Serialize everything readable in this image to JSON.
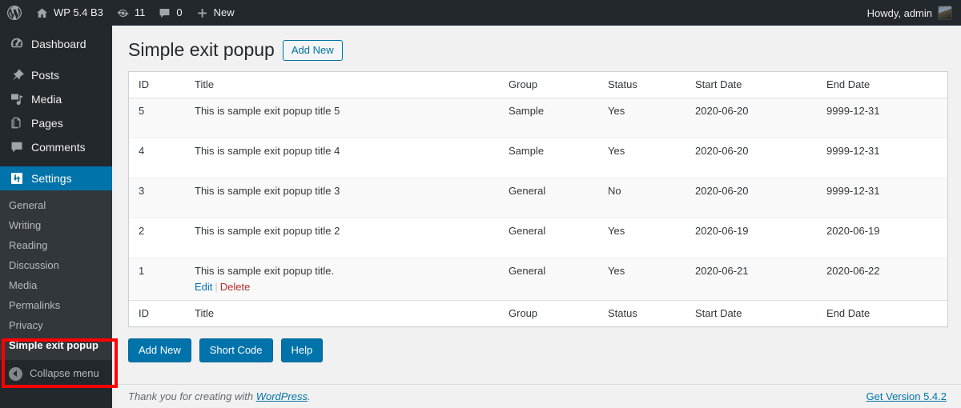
{
  "adminbar": {
    "logo_icon": "wordpress-logo-icon",
    "site": {
      "icon": "home-icon",
      "label": "WP 5.4 B3"
    },
    "updates": {
      "icon": "updates-icon",
      "count": "11"
    },
    "comments": {
      "icon": "comment-bubble-icon",
      "count": "0"
    },
    "new": {
      "icon": "plus-icon",
      "label": "New"
    },
    "account": {
      "greeting": "Howdy, admin",
      "avatar_icon": "user-avatar-icon"
    }
  },
  "sidebar": {
    "top_items": [
      {
        "label": "Dashboard",
        "icon": "dashboard-icon",
        "current": false
      },
      {
        "label": "Posts",
        "icon": "pin-icon",
        "current": false
      },
      {
        "label": "Media",
        "icon": "media-icon",
        "current": false
      },
      {
        "label": "Pages",
        "icon": "pages-icon",
        "current": false
      },
      {
        "label": "Comments",
        "icon": "comment-bubble-icon",
        "current": false
      },
      {
        "label": "Settings",
        "icon": "settings-sliders-icon",
        "current": true
      }
    ],
    "submenu": [
      {
        "label": "General",
        "current": false
      },
      {
        "label": "Writing",
        "current": false
      },
      {
        "label": "Reading",
        "current": false
      },
      {
        "label": "Discussion",
        "current": false
      },
      {
        "label": "Media",
        "current": false
      },
      {
        "label": "Permalinks",
        "current": false
      },
      {
        "label": "Privacy",
        "current": false
      },
      {
        "label": "Simple exit popup",
        "current": true
      }
    ],
    "collapse": {
      "label": "Collapse menu",
      "icon": "collapse-arrow-icon"
    },
    "annotation_color": "#ff0000"
  },
  "page": {
    "title": "Simple exit popup",
    "add_new_top_label": "Add New"
  },
  "table": {
    "columns": [
      "ID",
      "Title",
      "Group",
      "Status",
      "Start Date",
      "End Date"
    ],
    "rows": [
      {
        "id": "5",
        "title": "This is sample exit popup title 5",
        "group": "Sample",
        "status": "Yes",
        "status_state": "yes",
        "start_date": "2020-06-20",
        "start_alert": false,
        "end_date": "9999-12-31",
        "end_alert": false,
        "actions": null
      },
      {
        "id": "4",
        "title": "This is sample exit popup title 4",
        "group": "Sample",
        "status": "Yes",
        "status_state": "yes",
        "start_date": "2020-06-20",
        "start_alert": false,
        "end_date": "9999-12-31",
        "end_alert": false,
        "actions": null
      },
      {
        "id": "3",
        "title": "This is sample exit popup title 3",
        "group": "General",
        "status": "No",
        "status_state": "no",
        "start_date": "2020-06-20",
        "start_alert": false,
        "end_date": "9999-12-31",
        "end_alert": false,
        "actions": null
      },
      {
        "id": "2",
        "title": "This is sample exit popup title 2",
        "group": "General",
        "status": "Yes",
        "status_state": "yes",
        "start_date": "2020-06-19",
        "start_alert": false,
        "end_date": "2020-06-19",
        "end_alert": true,
        "actions": null
      },
      {
        "id": "1",
        "title": "This is sample exit popup title.",
        "group": "General",
        "status": "Yes",
        "status_state": "yes",
        "start_date": "2020-06-21",
        "start_alert": true,
        "end_date": "2020-06-22",
        "end_alert": false,
        "actions": {
          "edit": "Edit",
          "delete": "Delete"
        }
      }
    ]
  },
  "buttons": [
    {
      "label": "Add New",
      "name": "add-new-button"
    },
    {
      "label": "Short Code",
      "name": "short-code-button"
    },
    {
      "label": "Help",
      "name": "help-button"
    }
  ],
  "footer": {
    "thanks_prefix": "Thank you for creating with ",
    "wordpress_link": "WordPress",
    "thanks_suffix": ".",
    "version_link": "Get Version 5.4.2"
  },
  "colors": {
    "admin_dark": "#23282d",
    "admin_submenu": "#32373c",
    "accent_blue": "#0073aa",
    "status_yes": "#1a7a29",
    "status_no": "#e02222",
    "annotation": "#ff0000"
  }
}
